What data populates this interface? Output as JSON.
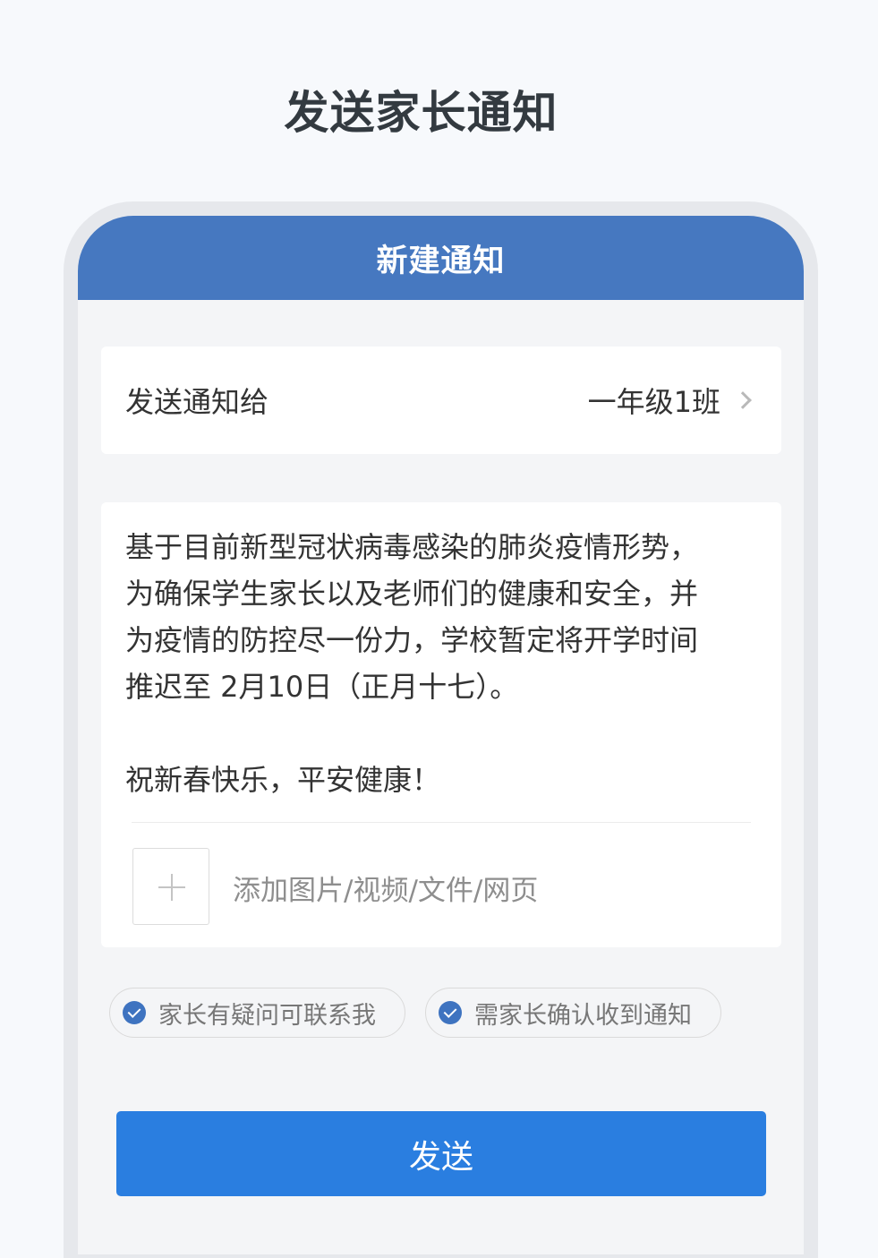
{
  "page": {
    "title": "发送家长通知"
  },
  "nav": {
    "title": "新建通知"
  },
  "recipient": {
    "label": "发送通知给",
    "value": "一年级1班",
    "chevron_icon": "chevron-right-icon"
  },
  "message": {
    "lines": [
      "基于目前新型冠状病毒感染的肺炎疫情形势，",
      "为确保学生家长以及老师们的健康和安全，并",
      "为疫情的防控尽一份力，学校暂定将开学时间",
      "推迟至 2月10日（正月十七）。",
      "",
      "祝新春快乐，平安健康！"
    ]
  },
  "attachment": {
    "label": "添加图片/视频/文件/网页",
    "icon": "plus-icon"
  },
  "options": [
    {
      "label": "家长有疑问可联系我",
      "checked": true
    },
    {
      "label": "需家长确认收到通知",
      "checked": true
    }
  ],
  "actions": {
    "send_label": "发送"
  },
  "colors": {
    "nav_bar": "#4678c0",
    "send_button": "#2a7ee0",
    "check": "#3e73c0",
    "background": "#f7f9fc"
  }
}
